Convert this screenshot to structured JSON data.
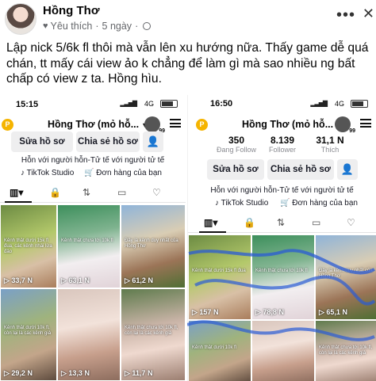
{
  "post": {
    "author": "Hồng Thơ",
    "badge": "Yêu thích",
    "time": "5 ngày",
    "text": "Lập nick 5/6k fl thôi mà vẫn lên xu hướng nữa. Thấy game dễ quá chán, tt mấy cái view ảo k chẳng để làm gì mà sao nhiều ng bất chấp có view z ta. Hồng hìu."
  },
  "left": {
    "time": "15:15",
    "net": "4G",
    "profile_name": "Hồng Thơ (mỏ hỗ...",
    "badge_count": "99",
    "edit_label": "Sửa hồ sơ",
    "share_label": "Chia sẻ hồ sơ",
    "bio": "Hỗn với người hỗn-Tử tế với người tử tế",
    "link1": "TikTok Studio",
    "link2": "Đơn hàng của bạn",
    "views": [
      "33,7 N",
      "63,1 N",
      "61,2 N",
      "29,2 N",
      "13,3 N",
      "11,7 N"
    ],
    "captions": [
      "Kênh thật dưới 15k fl đua, các kênh nhái lừa đảo",
      "Kênh thật chưa tới 10k fl",
      "Đây là kênh duy nhất của Hồng Thơ",
      "Kênh thật dưới 10k fl, còn lại là các kênh giả",
      "",
      "Kênh thật chưa tới 10k fl, còn lại là các kênh giả"
    ]
  },
  "right": {
    "time": "16:50",
    "net": "4G",
    "profile_name": "Hồng Thơ (mỏ hỗ...",
    "badge_count": "99",
    "stats": [
      {
        "value": "350",
        "label": "Đang Follow"
      },
      {
        "value": "8.139",
        "label": "Follower"
      },
      {
        "value": "31,1 N",
        "label": "Thích"
      }
    ],
    "edit_label": "Sửa hồ sơ",
    "share_label": "Chia sẻ hồ sơ",
    "bio": "Hỗn với người hỗn-Tử tế với người tử tế",
    "link1": "TikTok Studio",
    "link2": "Đơn hàng của bạn",
    "views": [
      "157 N",
      "78,8 N",
      "65,1 N",
      "",
      "",
      ""
    ],
    "captions": [
      "Kênh thật dưới 15k fl đua",
      "Kênh thật chưa tới 10k fl",
      "Đây là kênh duy nhất của Hồng Thơ",
      "Kênh thật dưới 10k fl",
      "",
      "Kênh thật chưa tới 10k fl, còn lại là các kênh giả"
    ]
  }
}
